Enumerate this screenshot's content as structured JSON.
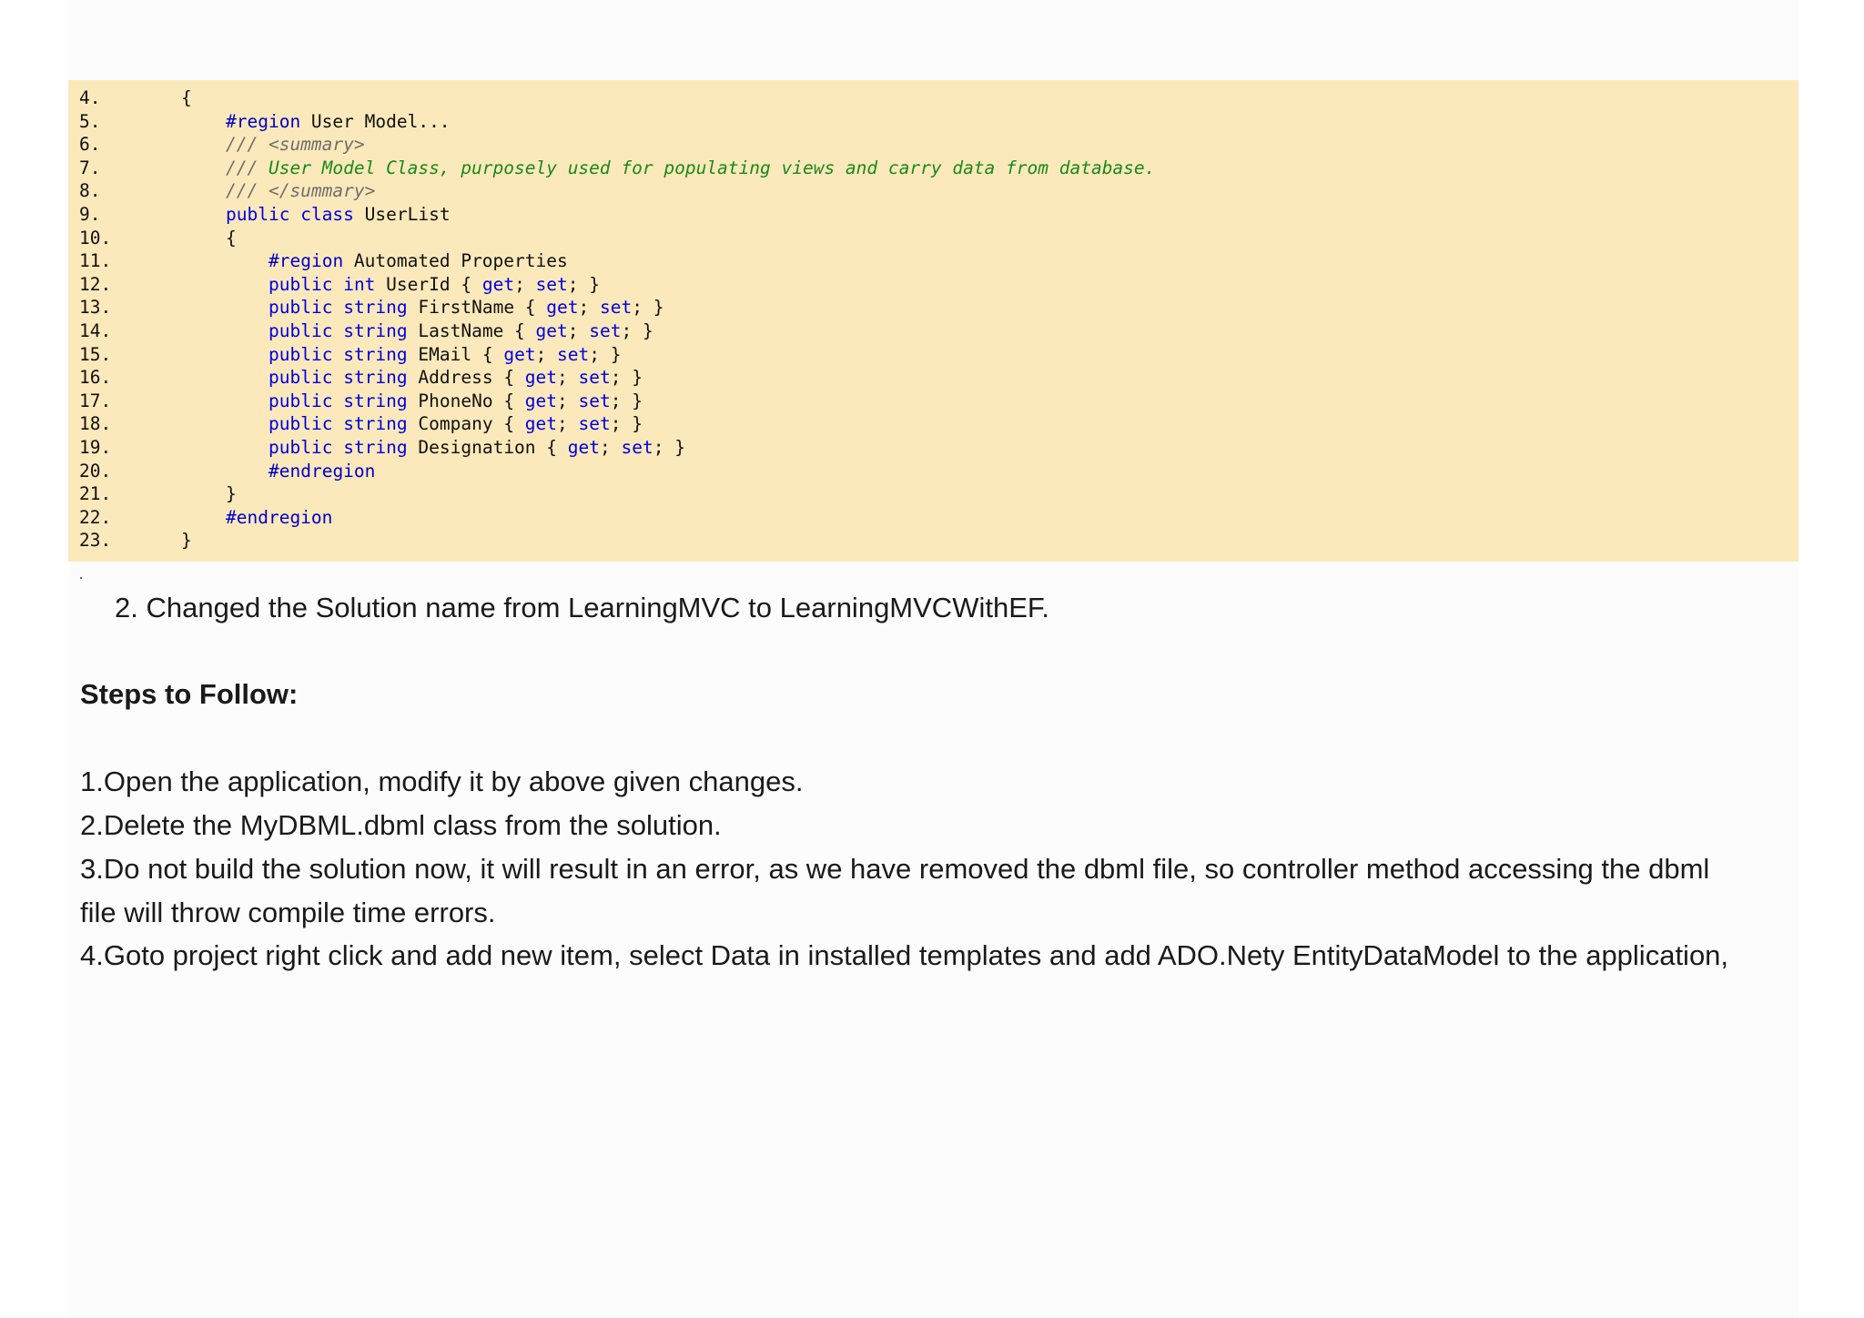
{
  "code": {
    "lines": [
      {
        "num": "4.",
        "indent": 0,
        "tokens": [
          {
            "t": "{",
            "c": "p"
          }
        ]
      },
      {
        "num": "5.",
        "indent": 1,
        "tokens": [
          {
            "t": "#region",
            "c": "dir"
          },
          {
            "t": " User Model...",
            "c": "p"
          }
        ]
      },
      {
        "num": "6.",
        "indent": 1,
        "tokens": [
          {
            "t": "/// <summary>",
            "c": "cm"
          }
        ]
      },
      {
        "num": "7.",
        "indent": 1,
        "tokens": [
          {
            "t": "/// ",
            "c": "cm"
          },
          {
            "t": "User Model Class, purposely used for populating views and carry data from database.",
            "c": "cmg"
          }
        ]
      },
      {
        "num": "8.",
        "indent": 1,
        "tokens": [
          {
            "t": "/// </summary>",
            "c": "cm"
          }
        ]
      },
      {
        "num": "9.",
        "indent": 1,
        "tokens": [
          {
            "t": "public",
            "c": "kw"
          },
          {
            "t": " ",
            "c": "p"
          },
          {
            "t": "class",
            "c": "kw"
          },
          {
            "t": " UserList",
            "c": "p"
          }
        ]
      },
      {
        "num": "10.",
        "indent": 1,
        "tokens": [
          {
            "t": "{",
            "c": "p"
          }
        ]
      },
      {
        "num": "11.",
        "indent": 2,
        "tokens": [
          {
            "t": "#region",
            "c": "dir"
          },
          {
            "t": " Automated Properties",
            "c": "p"
          }
        ]
      },
      {
        "num": "12.",
        "indent": 2,
        "tokens": [
          {
            "t": "public",
            "c": "kw"
          },
          {
            "t": " ",
            "c": "p"
          },
          {
            "t": "int",
            "c": "kw"
          },
          {
            "t": " UserId { ",
            "c": "p"
          },
          {
            "t": "get",
            "c": "kw"
          },
          {
            "t": "; ",
            "c": "p"
          },
          {
            "t": "set",
            "c": "kw"
          },
          {
            "t": "; }",
            "c": "p"
          }
        ]
      },
      {
        "num": "13.",
        "indent": 2,
        "tokens": [
          {
            "t": "public",
            "c": "kw"
          },
          {
            "t": " ",
            "c": "p"
          },
          {
            "t": "string",
            "c": "kw"
          },
          {
            "t": " FirstName { ",
            "c": "p"
          },
          {
            "t": "get",
            "c": "kw"
          },
          {
            "t": "; ",
            "c": "p"
          },
          {
            "t": "set",
            "c": "kw"
          },
          {
            "t": "; }",
            "c": "p"
          }
        ]
      },
      {
        "num": "14.",
        "indent": 2,
        "tokens": [
          {
            "t": "public",
            "c": "kw"
          },
          {
            "t": " ",
            "c": "p"
          },
          {
            "t": "string",
            "c": "kw"
          },
          {
            "t": " LastName { ",
            "c": "p"
          },
          {
            "t": "get",
            "c": "kw"
          },
          {
            "t": "; ",
            "c": "p"
          },
          {
            "t": "set",
            "c": "kw"
          },
          {
            "t": "; }",
            "c": "p"
          }
        ]
      },
      {
        "num": "15.",
        "indent": 2,
        "tokens": [
          {
            "t": "public",
            "c": "kw"
          },
          {
            "t": " ",
            "c": "p"
          },
          {
            "t": "string",
            "c": "kw"
          },
          {
            "t": " EMail { ",
            "c": "p"
          },
          {
            "t": "get",
            "c": "kw"
          },
          {
            "t": "; ",
            "c": "p"
          },
          {
            "t": "set",
            "c": "kw"
          },
          {
            "t": "; }",
            "c": "p"
          }
        ]
      },
      {
        "num": "16.",
        "indent": 2,
        "tokens": [
          {
            "t": "public",
            "c": "kw"
          },
          {
            "t": " ",
            "c": "p"
          },
          {
            "t": "string",
            "c": "kw"
          },
          {
            "t": " Address { ",
            "c": "p"
          },
          {
            "t": "get",
            "c": "kw"
          },
          {
            "t": "; ",
            "c": "p"
          },
          {
            "t": "set",
            "c": "kw"
          },
          {
            "t": "; }",
            "c": "p"
          }
        ]
      },
      {
        "num": "17.",
        "indent": 2,
        "tokens": [
          {
            "t": "public",
            "c": "kw"
          },
          {
            "t": " ",
            "c": "p"
          },
          {
            "t": "string",
            "c": "kw"
          },
          {
            "t": " PhoneNo { ",
            "c": "p"
          },
          {
            "t": "get",
            "c": "kw"
          },
          {
            "t": "; ",
            "c": "p"
          },
          {
            "t": "set",
            "c": "kw"
          },
          {
            "t": "; }",
            "c": "p"
          }
        ]
      },
      {
        "num": "18.",
        "indent": 2,
        "tokens": [
          {
            "t": "public",
            "c": "kw"
          },
          {
            "t": " ",
            "c": "p"
          },
          {
            "t": "string",
            "c": "kw"
          },
          {
            "t": " Company { ",
            "c": "p"
          },
          {
            "t": "get",
            "c": "kw"
          },
          {
            "t": "; ",
            "c": "p"
          },
          {
            "t": "set",
            "c": "kw"
          },
          {
            "t": "; }",
            "c": "p"
          }
        ]
      },
      {
        "num": "19.",
        "indent": 2,
        "tokens": [
          {
            "t": "public",
            "c": "kw"
          },
          {
            "t": " ",
            "c": "p"
          },
          {
            "t": "string",
            "c": "kw"
          },
          {
            "t": " Designation { ",
            "c": "p"
          },
          {
            "t": "get",
            "c": "kw"
          },
          {
            "t": "; ",
            "c": "p"
          },
          {
            "t": "set",
            "c": "kw"
          },
          {
            "t": "; }",
            "c": "p"
          }
        ]
      },
      {
        "num": "20.",
        "indent": 2,
        "tokens": [
          {
            "t": "#endregion",
            "c": "dir"
          }
        ]
      },
      {
        "num": "21.",
        "indent": 1,
        "tokens": [
          {
            "t": "}",
            "c": "p"
          }
        ]
      },
      {
        "num": "22.",
        "indent": 1,
        "tokens": [
          {
            "t": "#endregion",
            "c": "dir"
          }
        ]
      },
      {
        "num": "23.",
        "indent": 0,
        "tokens": [
          {
            "t": "}",
            "c": "p"
          }
        ]
      }
    ]
  },
  "doc": {
    "changed_item": "2. Changed the Solution name from LearningMVC to LearningMVCWithEF.",
    "steps_heading": "Steps to Follow:",
    "step1": "1.Open the application, modify it by above given changes.",
    "step2": "2.Delete the MyDBML.dbml class from the solution.",
    "step3_line1": "3.Do not build the solution now, it will result in an error, as we have removed the dbml file, so controller method accessing the  dbml",
    "step3_line2": "file will throw compile time errors.",
    "step4": "4.Goto project right click and add new item, select Data in installed templates and add ADO.Nety EntityDataModel to the application,"
  }
}
